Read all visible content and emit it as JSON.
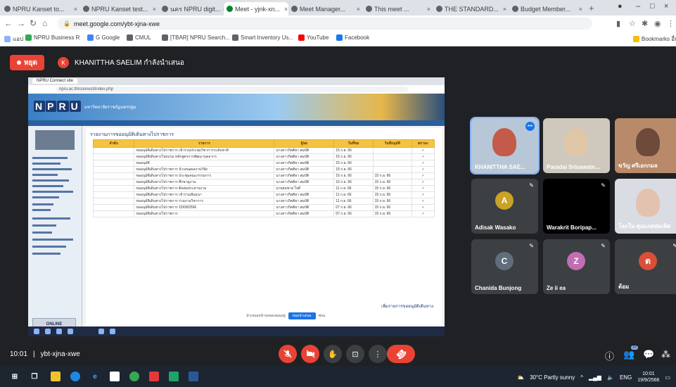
{
  "browser": {
    "tabs": [
      {
        "label": "NPRU Kanset to..."
      },
      {
        "label": "NPRU Kanset test..."
      },
      {
        "label": "นคร NPRU digit..."
      },
      {
        "label": "Meet - yjnk-xn...",
        "active": true
      },
      {
        "label": "Meet Manager..."
      },
      {
        "label": "This meet ..."
      },
      {
        "label": "THE STANDARD..."
      },
      {
        "label": "Budget Member..."
      }
    ],
    "url": "meet.google.com/ybt-xjna-xwe",
    "bookmarks": [
      "แอป",
      "NPRU Business R",
      "G Google",
      "CMUL",
      "[TBAR] NPRU Search...",
      "Smart Inventory Us...",
      "YouTube",
      "Facebook"
    ],
    "other_bookmarks": "Bookmarks อื่นๆ"
  },
  "meet": {
    "stop_presenting": "หยุด",
    "presenter_initial": "K",
    "presenter_name": "KHANITTHA SAELIM กำลังนำเสนอ",
    "meeting_time": "10:01",
    "meeting_code": "ybt-xjna-xwe"
  },
  "shared": {
    "tab_label": "NPRU Connect site",
    "url": "npru.ac.th/connect/index.php",
    "logo_letters": [
      "N",
      "P",
      "R",
      "U"
    ],
    "banner_sub": "มหาวิทยาลัยราชภัฏนครปฐม",
    "sidebar_footer": "ONLINE",
    "page_title": "รายงานการขออนุมัติเดินทางไปราชการ",
    "table_headers": [
      "ลำดับ",
      "รายการ",
      "ผู้ขอ",
      "วันที่ขอ",
      "วันที่อนุมัติ",
      "สถานะ"
    ],
    "rows": [
      [
        "",
        "ขออนุมัติเดินทางไปราชการ เข้าร่วมประชุมวิชาการระดับชาติ",
        "นางสาวกิตติยา สมบัติ",
        "15 ก.ย. 66",
        "",
        "✓"
      ],
      [
        "",
        "ขออนุมัติเดินทางไปอบรม หลักสูตรการพัฒนาบุคลากร",
        "นางสาวกิตติยา สมบัติ",
        "15 ก.ย. 66",
        "",
        "✓"
      ],
      [
        "",
        "ขออนุมัติ",
        "นางสาวกิตติยา สมบัติ",
        "15 ก.ย. 66",
        "",
        "✓"
      ],
      [
        "",
        "ขออนุมัติเดินทางไปราชการ นำเสนอผลงานวิจัย",
        "นางสาวกิตติยา สมบัติ",
        "15 ก.ย. 66",
        "",
        "✓"
      ],
      [
        "",
        "ขออนุมัติเดินทางไปราชการ ประชุมคณะกรรมการ",
        "นางสาวกิตติยา สมบัติ",
        "15 ก.ย. 66",
        "15 ก.ย. 66",
        "✓"
      ],
      [
        "",
        "ขออนุมัติเดินทางไปราชการ ศึกษาดูงาน",
        "นางสาวกิตติยา สมบัติ",
        "15 ก.ย. 66",
        "15 ก.ย. 66",
        "✓"
      ],
      [
        "",
        "ขออนุมัติเดินทางไปราชการ ติดต่อประสานงาน",
        "นายสมชาย ใจดี",
        "11 ก.ย. 66",
        "15 ก.ย. 66",
        "✓"
      ],
      [
        "",
        "ขออนุมัติเดินทางไปราชการ เข้าร่วมสัมมนา",
        "นางสาวกิตติยา สมบัติ",
        "11 ก.ย. 66",
        "15 ก.ย. 66",
        "✓"
      ],
      [
        "",
        "ขออนุมัติเดินทางไปราชการ ร่วมงานวิชาการ",
        "นางสาวกิตติยา สมบัติ",
        "11 ก.ย. 66",
        "15 ก.ย. 66",
        "✓"
      ],
      [
        "",
        "ขออนุมัติเดินทางไปราชการ 15/09/2566",
        "นางสาวกิตติยา สมบัติ",
        "07 ก.ย. 66",
        "15 ก.ย. 66",
        "✓"
      ],
      [
        "",
        "ขออนุมัติเดินทางไปราชการ",
        "นางสาวกิตติยา สมบัติ",
        "07 ก.ย. 66",
        "15 ก.ย. 66",
        "✓"
      ]
    ],
    "note": "เพิ่มรายการขออนุมัติเดินทาง",
    "footer_text": "นำเสนอหน้าจอของคุณอยู่",
    "footer_button": "หยุดนำเสนอ",
    "footer_hide": "ซ่อน"
  },
  "participants": [
    {
      "name": "KHANITTHA SAE...",
      "color": "#c45a4a",
      "bg": "#b7c7d8",
      "speaking": true
    },
    {
      "name": "Paradai Srisawatn...",
      "color": "#e0c7a8",
      "bg": "#cfc8bd"
    },
    {
      "name": "ขวัญ ศรีเอกกมล",
      "color": "#6d4a3a",
      "bg": "#b88a6a"
    },
    {
      "name": "Adisak Wasako",
      "avatar": "A",
      "avatar_color": "#c9a227"
    },
    {
      "name": "Warakrit Boripap...",
      "bg": "#000000"
    },
    {
      "name": "โลกใน คุณเกศสมเลิศ",
      "color": "#e4c2b0",
      "bg": "#d9dde3"
    },
    {
      "name": "Chanida Bunjong",
      "avatar": "C",
      "avatar_color": "#5f6e7a"
    },
    {
      "name": "Ze ii ea",
      "avatar": "Z",
      "avatar_color": "#c36db4"
    },
    {
      "name": "ต้อม",
      "avatar": "ต",
      "avatar_color": "#d94f3a"
    }
  ],
  "controls": {
    "mic": "mic-off",
    "camera": "camera-off",
    "raise_hand": "✋",
    "present": "⊡",
    "more": "⋮",
    "end": "☎"
  },
  "right_controls": {
    "info": "ⓘ",
    "people": "👥",
    "people_count": "10",
    "chat": "💬",
    "activities": "⁂"
  },
  "taskbar": {
    "weather": "30°C Partly sunny",
    "lang": "ENG",
    "time": "10:01",
    "date": "19/9/2566"
  }
}
